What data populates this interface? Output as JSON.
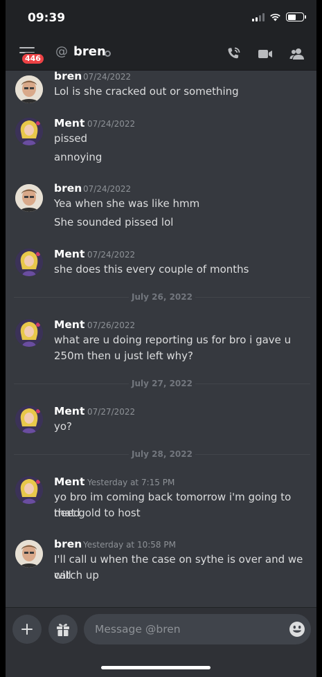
{
  "status_bar": {
    "time": "09:39"
  },
  "header": {
    "unread_badge": "446",
    "at_symbol": "@",
    "username": "bren"
  },
  "messages": [
    {
      "author": "bren",
      "timestamp": "07/24/2022",
      "lines": [
        "Lol is she cracked out or something"
      ]
    },
    {
      "author": "Ment",
      "timestamp": "07/24/2022",
      "lines": [
        "pissed",
        "annoying"
      ]
    },
    {
      "author": "bren",
      "timestamp": "07/24/2022",
      "lines": [
        "Yea when she was like hmm",
        "She sounded pissed lol"
      ]
    },
    {
      "author": "Ment",
      "timestamp": "07/24/2022",
      "lines": [
        "she does this every couple of months"
      ]
    },
    {
      "author": "Ment",
      "timestamp": "07/26/2022",
      "lines": [
        "what are u doing reporting us for bro i gave u",
        "250m then u just left why?"
      ]
    },
    {
      "author": "Ment",
      "timestamp": "07/27/2022",
      "lines": [
        "yo?"
      ]
    },
    {
      "author": "Ment",
      "timestamp": "Yesterday at 7:15 PM",
      "lines": [
        "yo bro im coming back tomorrow i'm going to need",
        "that gold to host"
      ]
    },
    {
      "author": "bren",
      "timestamp": "Yesterday at 10:58 PM",
      "lines": [
        "I'll call u when the case on sythe is over and we will",
        "catch up"
      ]
    }
  ],
  "dividers": [
    "July 26, 2022",
    "July 27, 2022",
    "July 28, 2022"
  ],
  "composer": {
    "placeholder": "Message @bren"
  },
  "icons": {
    "header": [
      "menu-icon",
      "call-icon",
      "video-icon",
      "members-icon"
    ],
    "composer": [
      "plus-icon",
      "gift-icon",
      "emoji-icon"
    ],
    "status_bar": [
      "signal-icon",
      "wifi-icon",
      "battery-icon"
    ]
  },
  "colors": {
    "background": "#36393f",
    "header": "#202225",
    "badge": "#ed4245",
    "divider_text": "#72767d"
  }
}
